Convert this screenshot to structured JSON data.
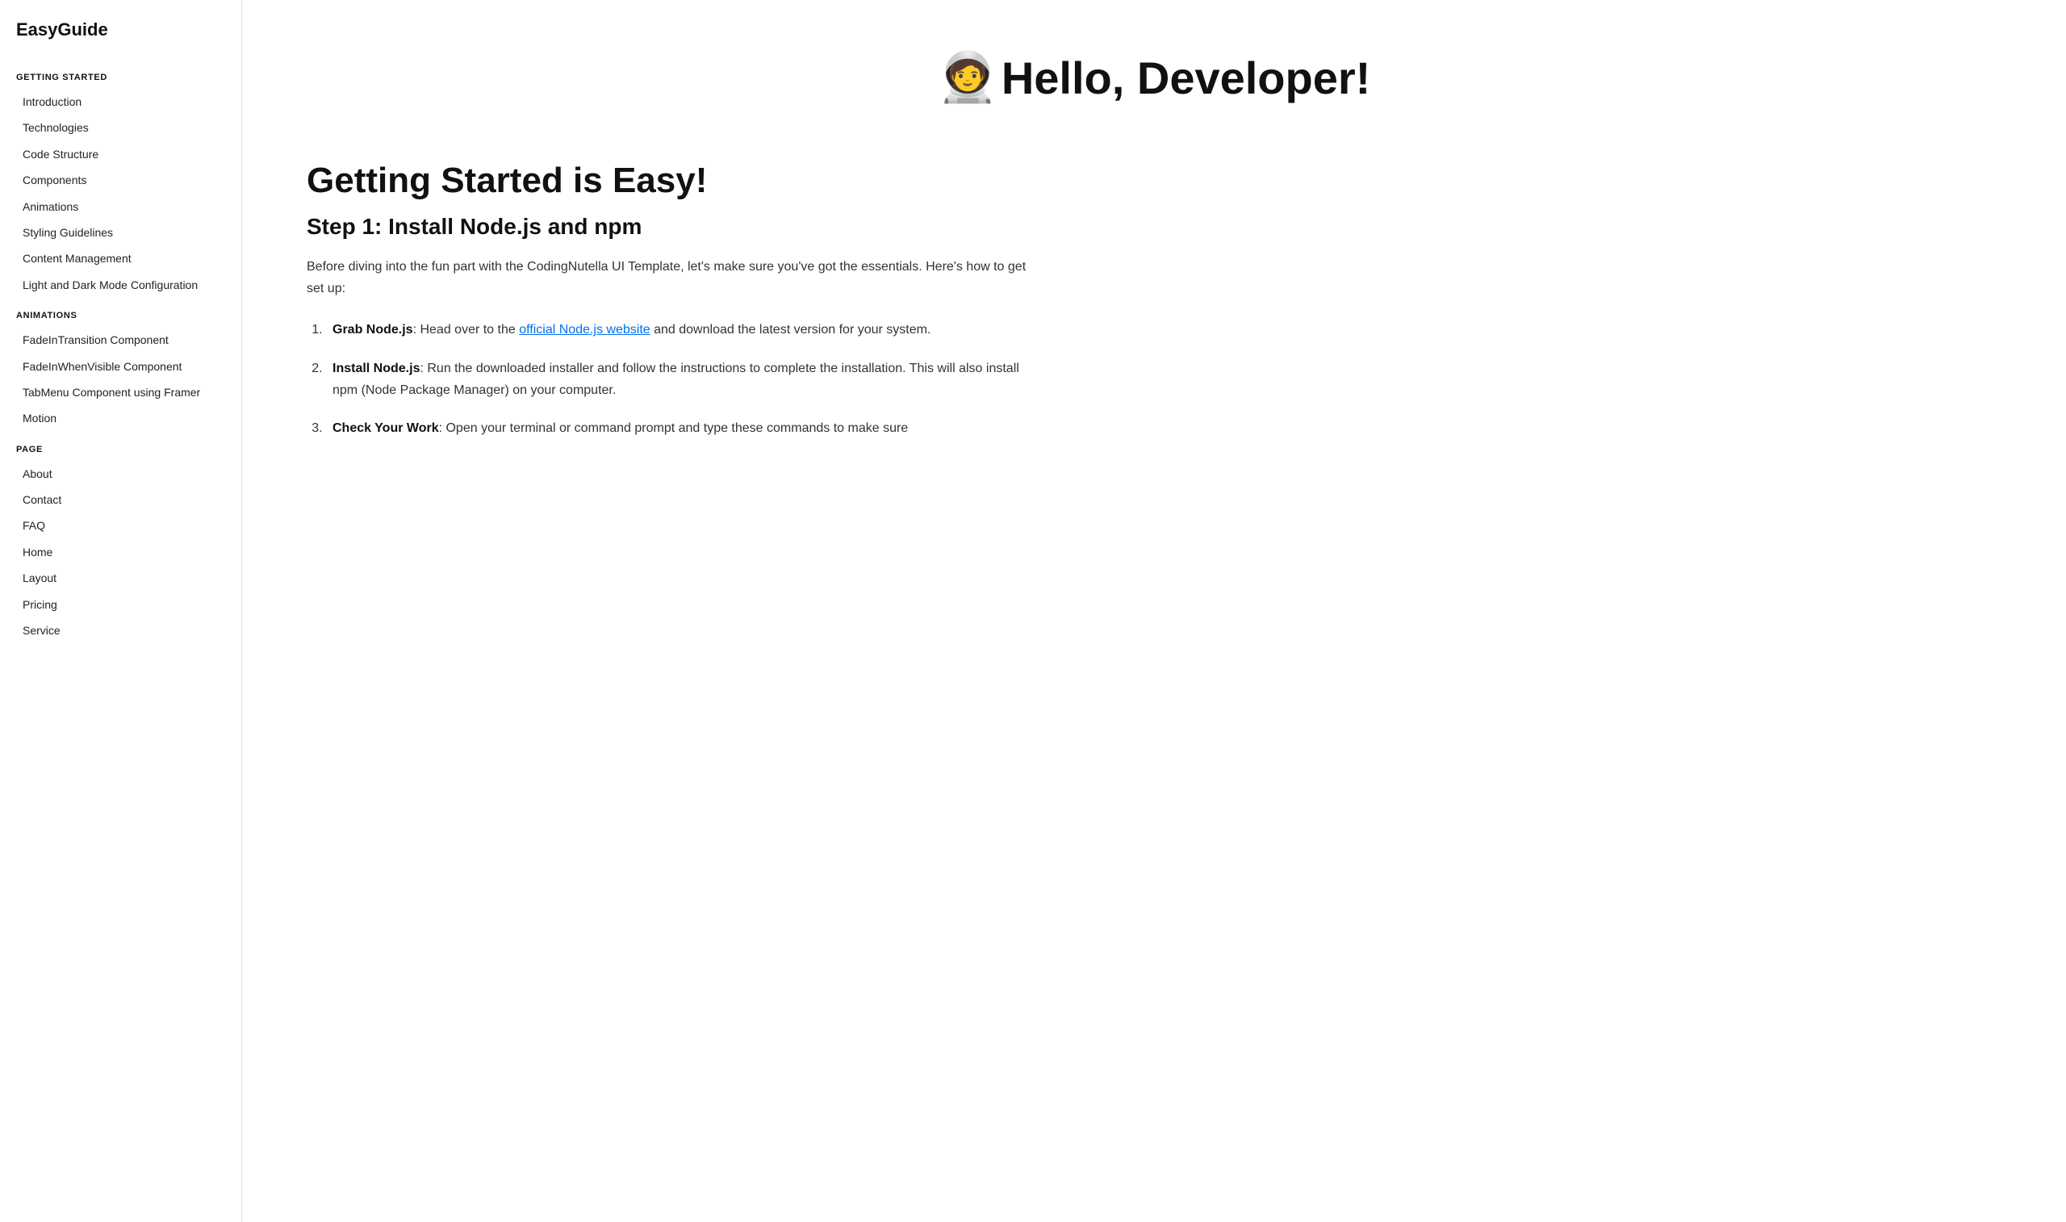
{
  "sidebar": {
    "logo": "EasyGuide",
    "sections": [
      {
        "id": "getting-started",
        "label": "GETTING STARTED",
        "items": [
          {
            "id": "introduction",
            "label": "Introduction"
          },
          {
            "id": "technologies",
            "label": "Technologies"
          },
          {
            "id": "code-structure",
            "label": "Code Structure"
          },
          {
            "id": "components",
            "label": "Components"
          },
          {
            "id": "animations",
            "label": "Animations"
          },
          {
            "id": "styling-guidelines",
            "label": "Styling Guidelines"
          },
          {
            "id": "content-management",
            "label": "Content Management"
          },
          {
            "id": "light-dark-mode",
            "label": "Light and Dark Mode Configuration"
          }
        ]
      },
      {
        "id": "animations",
        "label": "ANIMATIONS",
        "items": [
          {
            "id": "fadein-transition",
            "label": "FadeInTransition Component"
          },
          {
            "id": "fadein-visible",
            "label": "FadeInWhenVisible Component"
          },
          {
            "id": "tabmenu-framer",
            "label": "TabMenu Component using Framer"
          },
          {
            "id": "motion",
            "label": "Motion"
          }
        ]
      },
      {
        "id": "page",
        "label": "PAGE",
        "items": [
          {
            "id": "about",
            "label": "About"
          },
          {
            "id": "contact",
            "label": "Contact"
          },
          {
            "id": "faq",
            "label": "FAQ"
          },
          {
            "id": "home",
            "label": "Home"
          },
          {
            "id": "layout",
            "label": "Layout"
          },
          {
            "id": "pricing",
            "label": "Pricing"
          },
          {
            "id": "service",
            "label": "Service"
          }
        ]
      }
    ]
  },
  "main": {
    "hero": {
      "emoji": "🧑‍🚀",
      "title": "Hello, Developer!"
    },
    "section_title": "Getting Started is Easy!",
    "step1": {
      "heading": "Step 1: Install Node.js and npm",
      "intro": "Before diving into the fun part with the CodingNutella UI Template, let's make sure you've got the essentials. Here's how to get set up:",
      "steps": [
        {
          "bold": "Grab Node.js",
          "link_text": "official Node.js website",
          "link_href": "#",
          "text_before": ": Head over to the ",
          "text_after": " and download the latest version for your system."
        },
        {
          "bold": "Install Node.js",
          "text": ": Run the downloaded installer and follow the instructions to complete the installation. This will also install npm (Node Package Manager) on your computer."
        },
        {
          "bold": "Check Your Work",
          "text": ": Open your terminal or command prompt and type these commands to make sure"
        }
      ]
    }
  }
}
